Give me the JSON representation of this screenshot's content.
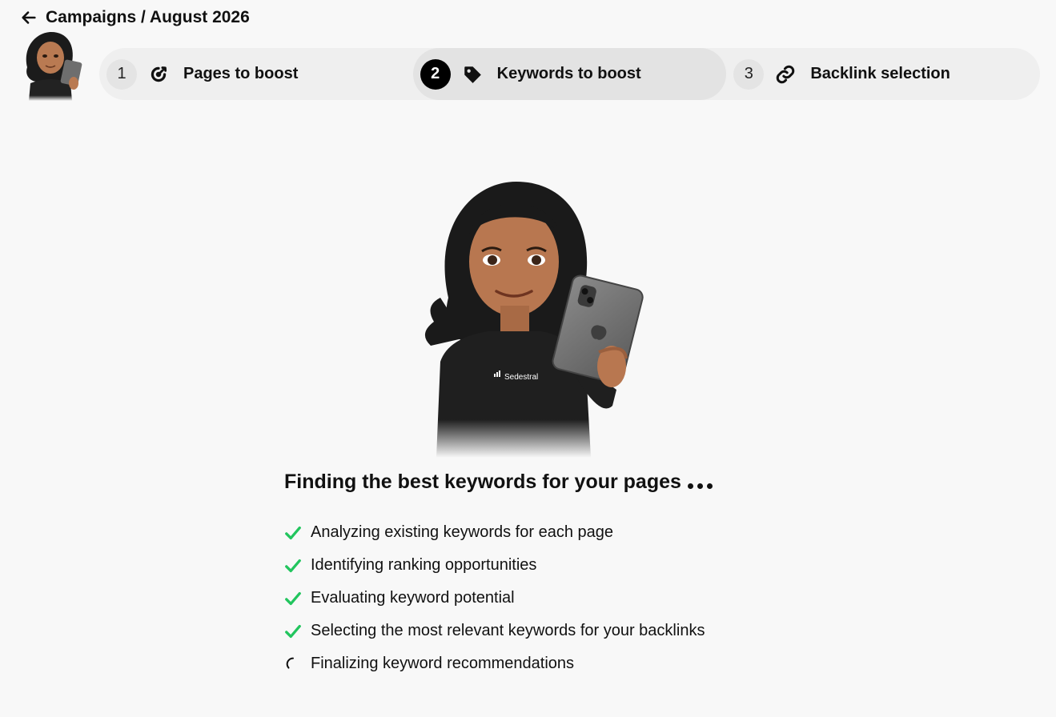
{
  "header": {
    "back_icon": "arrow-left-icon",
    "breadcrumb": "Campaigns / August 2026"
  },
  "stepper": {
    "steps": [
      {
        "number": "1",
        "label": "Pages to boost",
        "icon": "target-icon",
        "active": false
      },
      {
        "number": "2",
        "label": "Keywords to boost",
        "icon": "tag-icon",
        "active": true
      },
      {
        "number": "3",
        "label": "Backlink selection",
        "icon": "link-icon",
        "active": false
      }
    ]
  },
  "hero": {
    "shirt_text": "Sedestral"
  },
  "progress": {
    "title": "Finding the best keywords for your pages",
    "tasks": [
      {
        "label": "Analyzing existing keywords for each page",
        "status": "done"
      },
      {
        "label": "Identifying ranking opportunities",
        "status": "done"
      },
      {
        "label": "Evaluating keyword potential",
        "status": "done"
      },
      {
        "label": "Selecting the most relevant keywords for your backlinks",
        "status": "done"
      },
      {
        "label": "Finalizing keyword recommendations",
        "status": "in-progress"
      }
    ]
  },
  "colors": {
    "check": "#22c55e",
    "active_step": "#000000",
    "background": "#f8f8f8"
  }
}
